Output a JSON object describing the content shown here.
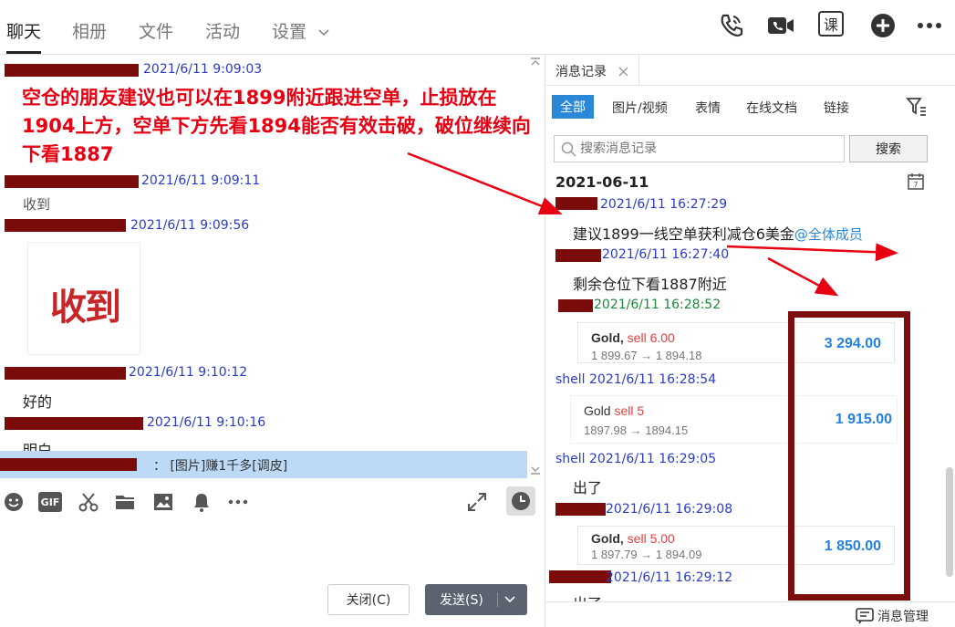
{
  "nav": {
    "tabs": [
      "聊天",
      "相册",
      "文件",
      "活动",
      "设置"
    ],
    "icons": [
      "phone-icon",
      "video-icon",
      "class-icon",
      "plus-icon",
      "more-icon"
    ],
    "class_label": "课"
  },
  "chat": {
    "messages": [
      {
        "time": "2021/6/11 9:09:03"
      },
      {
        "time": "2021/6/11 9:09:11",
        "text": "收到"
      },
      {
        "time": "2021/6/11 9:09:56",
        "sticker": "收到"
      },
      {
        "time": "2021/6/11 9:10:12",
        "text": "好的"
      },
      {
        "time": "2021/6/11 9:10:16",
        "text": "明白"
      }
    ],
    "annotation": "空仓的朋友建议也可以在1899附近跟进空单，止损放在1904上方，空单下方先看1894能否有效击破，破位继续向下看1887",
    "quote_text": "：  [图片]赚1千多[调皮]",
    "toolbar_icons": [
      "emoji-icon",
      "gif-icon",
      "scissors-icon",
      "folder-icon",
      "image-icon",
      "bell-icon",
      "more-icon"
    ],
    "gif_label": "GIF",
    "close_button": "关闭(C)",
    "send_button": "发送(S)"
  },
  "history": {
    "tab_title": "消息记录",
    "filters": [
      "全部",
      "图片/视频",
      "表情",
      "在线文档",
      "链接"
    ],
    "search_placeholder": "搜索消息记录",
    "search_button": "搜索",
    "date": "2021-06-11",
    "entries": [
      {
        "meta": "2021/6/11 16:27:29",
        "text": "建议1899一线空单获利减仓6美金",
        "mention": "@全体成员"
      },
      {
        "meta": "2021/6/11 16:27:40",
        "text": "剩余仓位下看1887附近"
      },
      {
        "meta": "2021/6/11 16:28:52"
      },
      {
        "meta": "shell 2021/6/11 16:28:54"
      },
      {
        "meta": "shell 2021/6/11 16:29:05",
        "text": "出了"
      },
      {
        "meta": "2021/6/11 16:29:08"
      },
      {
        "meta": "2021/6/11 16:29:12",
        "text": "出了"
      }
    ],
    "cards": [
      {
        "asset": "Gold,",
        "side": "sell 6.00",
        "prices": "1 899.67 → 1 894.18",
        "profit": "3 294.00"
      },
      {
        "asset": "Gold",
        "side": "sell 5",
        "prices": "1897.98 → 1894.15",
        "profit": "1 915.00"
      },
      {
        "asset": "Gold,",
        "side": "sell 5.00",
        "prices": "1 897.79 → 1 894.09",
        "profit": "1 850.00"
      }
    ],
    "manage_label": "消息管理"
  }
}
